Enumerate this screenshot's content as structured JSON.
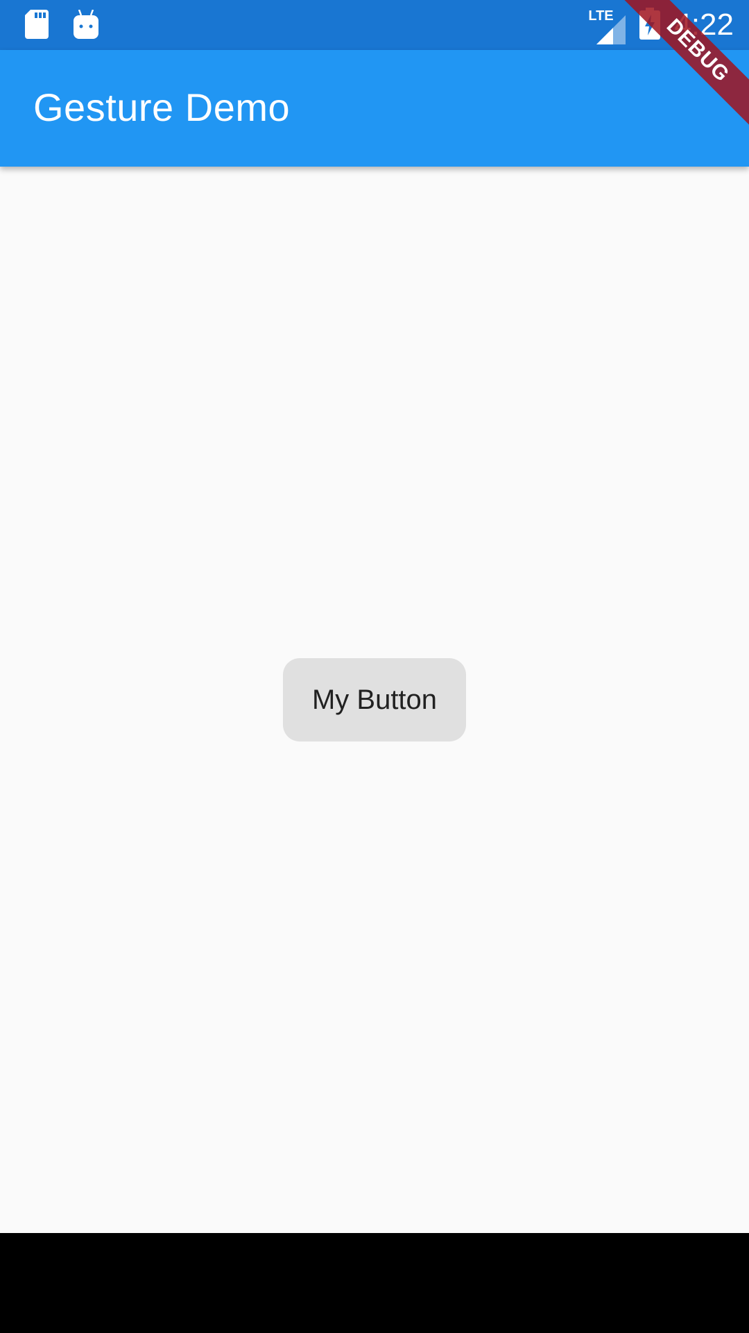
{
  "status_bar": {
    "time": "4:22",
    "network": "LTE",
    "icons": [
      "sd-card-icon",
      "android-icon",
      "signal-icon",
      "battery-charging-icon"
    ]
  },
  "app_bar": {
    "title": "Gesture Demo"
  },
  "main": {
    "button_label": "My Button"
  },
  "debug_banner": {
    "label": "DEBUG"
  },
  "colors": {
    "status_bar": "#1976d2",
    "app_bar": "#2196f3",
    "background": "#fafafa",
    "button": "#e0e0e0",
    "debug_banner": "#a0141e"
  }
}
